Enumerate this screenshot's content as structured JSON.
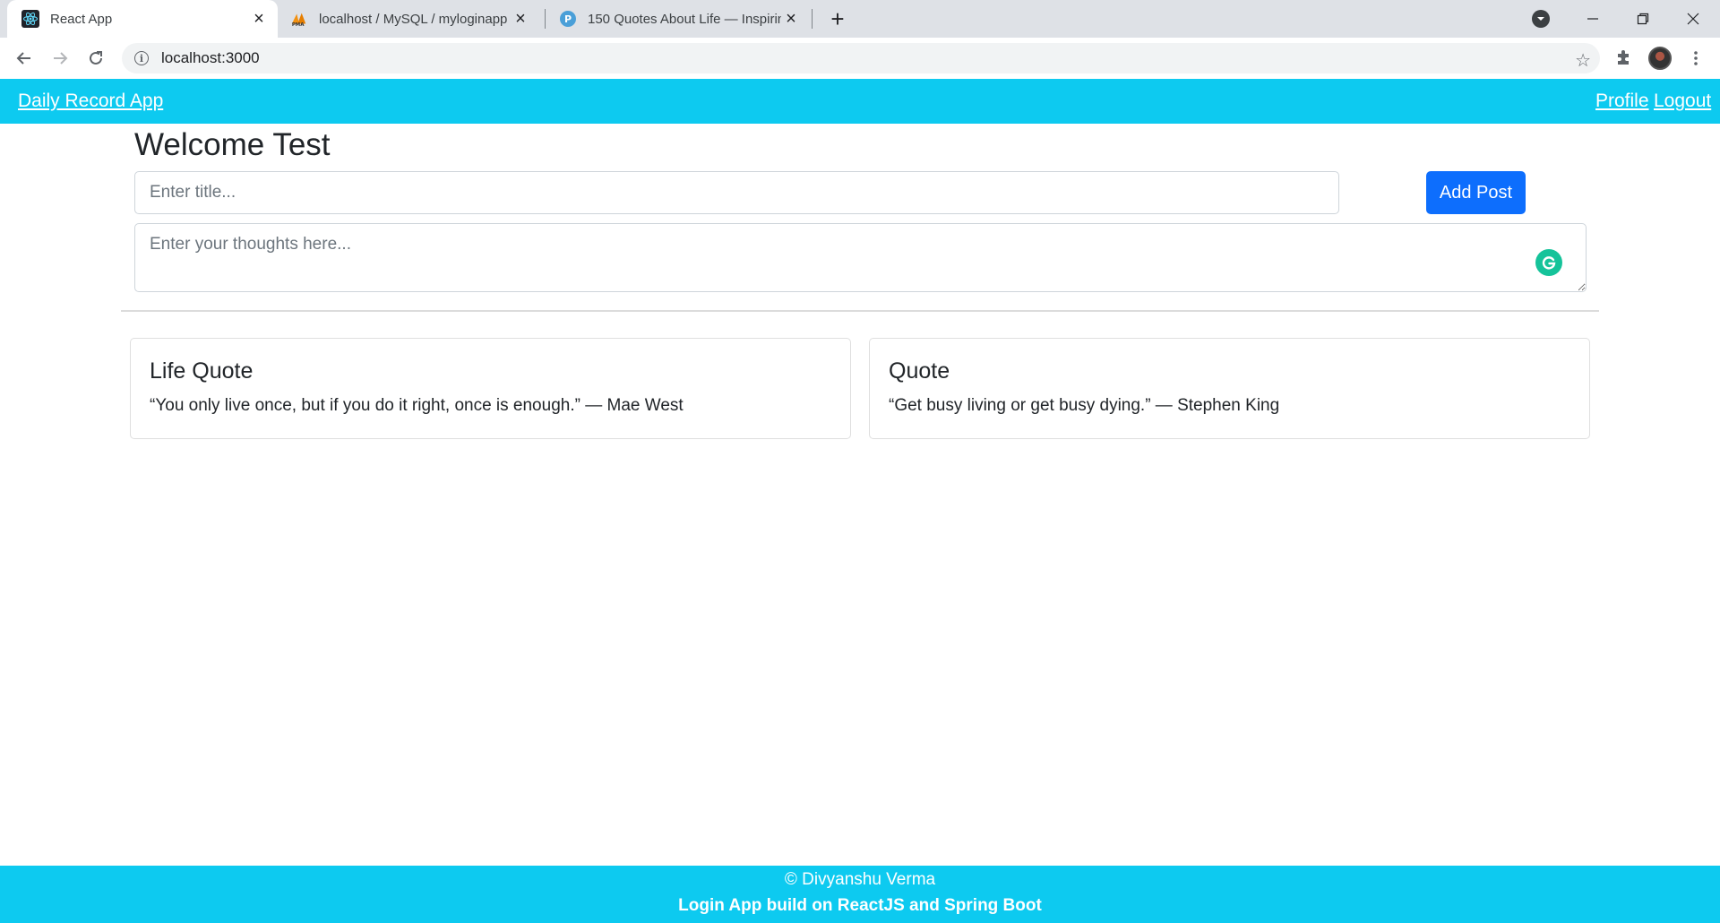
{
  "browser": {
    "tabs": [
      {
        "title": "React App",
        "icon": "react-icon",
        "active": true
      },
      {
        "title": "localhost / MySQL / myloginapp",
        "icon": "phpmyadmin-icon",
        "active": false
      },
      {
        "title": "150 Quotes About Life — Inspirin",
        "icon": "p-letter-icon",
        "active": false
      }
    ],
    "url": "localhost:3000",
    "colors": {
      "tabstrip": "#dee1e6",
      "omnibox": "#f1f3f4"
    }
  },
  "app": {
    "brand": "Daily Record App",
    "nav": {
      "profile": "Profile",
      "logout": "Logout"
    },
    "welcome": "Welcome Test",
    "form": {
      "title_placeholder": "Enter title...",
      "thoughts_placeholder": "Enter your thoughts here...",
      "add_button": "Add Post"
    },
    "posts": [
      {
        "title": "Life Quote",
        "text": "“You only live once, but if you do it right, once is enough.” — Mae West"
      },
      {
        "title": "Quote",
        "text": "“Get busy living or get busy dying.” — Stephen King"
      }
    ],
    "footer": {
      "line1": "© Divyanshu Verma",
      "line2": "Login App build on ReactJS and Spring Boot"
    },
    "colors": {
      "nav": "#0dcaf0",
      "primary_button": "#0d6efd",
      "grammarly": "#15c39a"
    }
  }
}
